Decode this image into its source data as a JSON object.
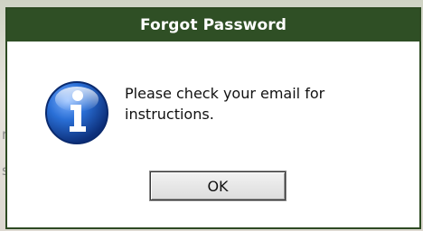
{
  "dialog": {
    "title": "Forgot Password",
    "message": "Please check your email for instructions.",
    "ok_label": "OK",
    "icon": "info-icon"
  },
  "colors": {
    "titlebar": "#2f4f25",
    "title_text": "#ffffff",
    "icon_blue": "#1f5fc4"
  }
}
